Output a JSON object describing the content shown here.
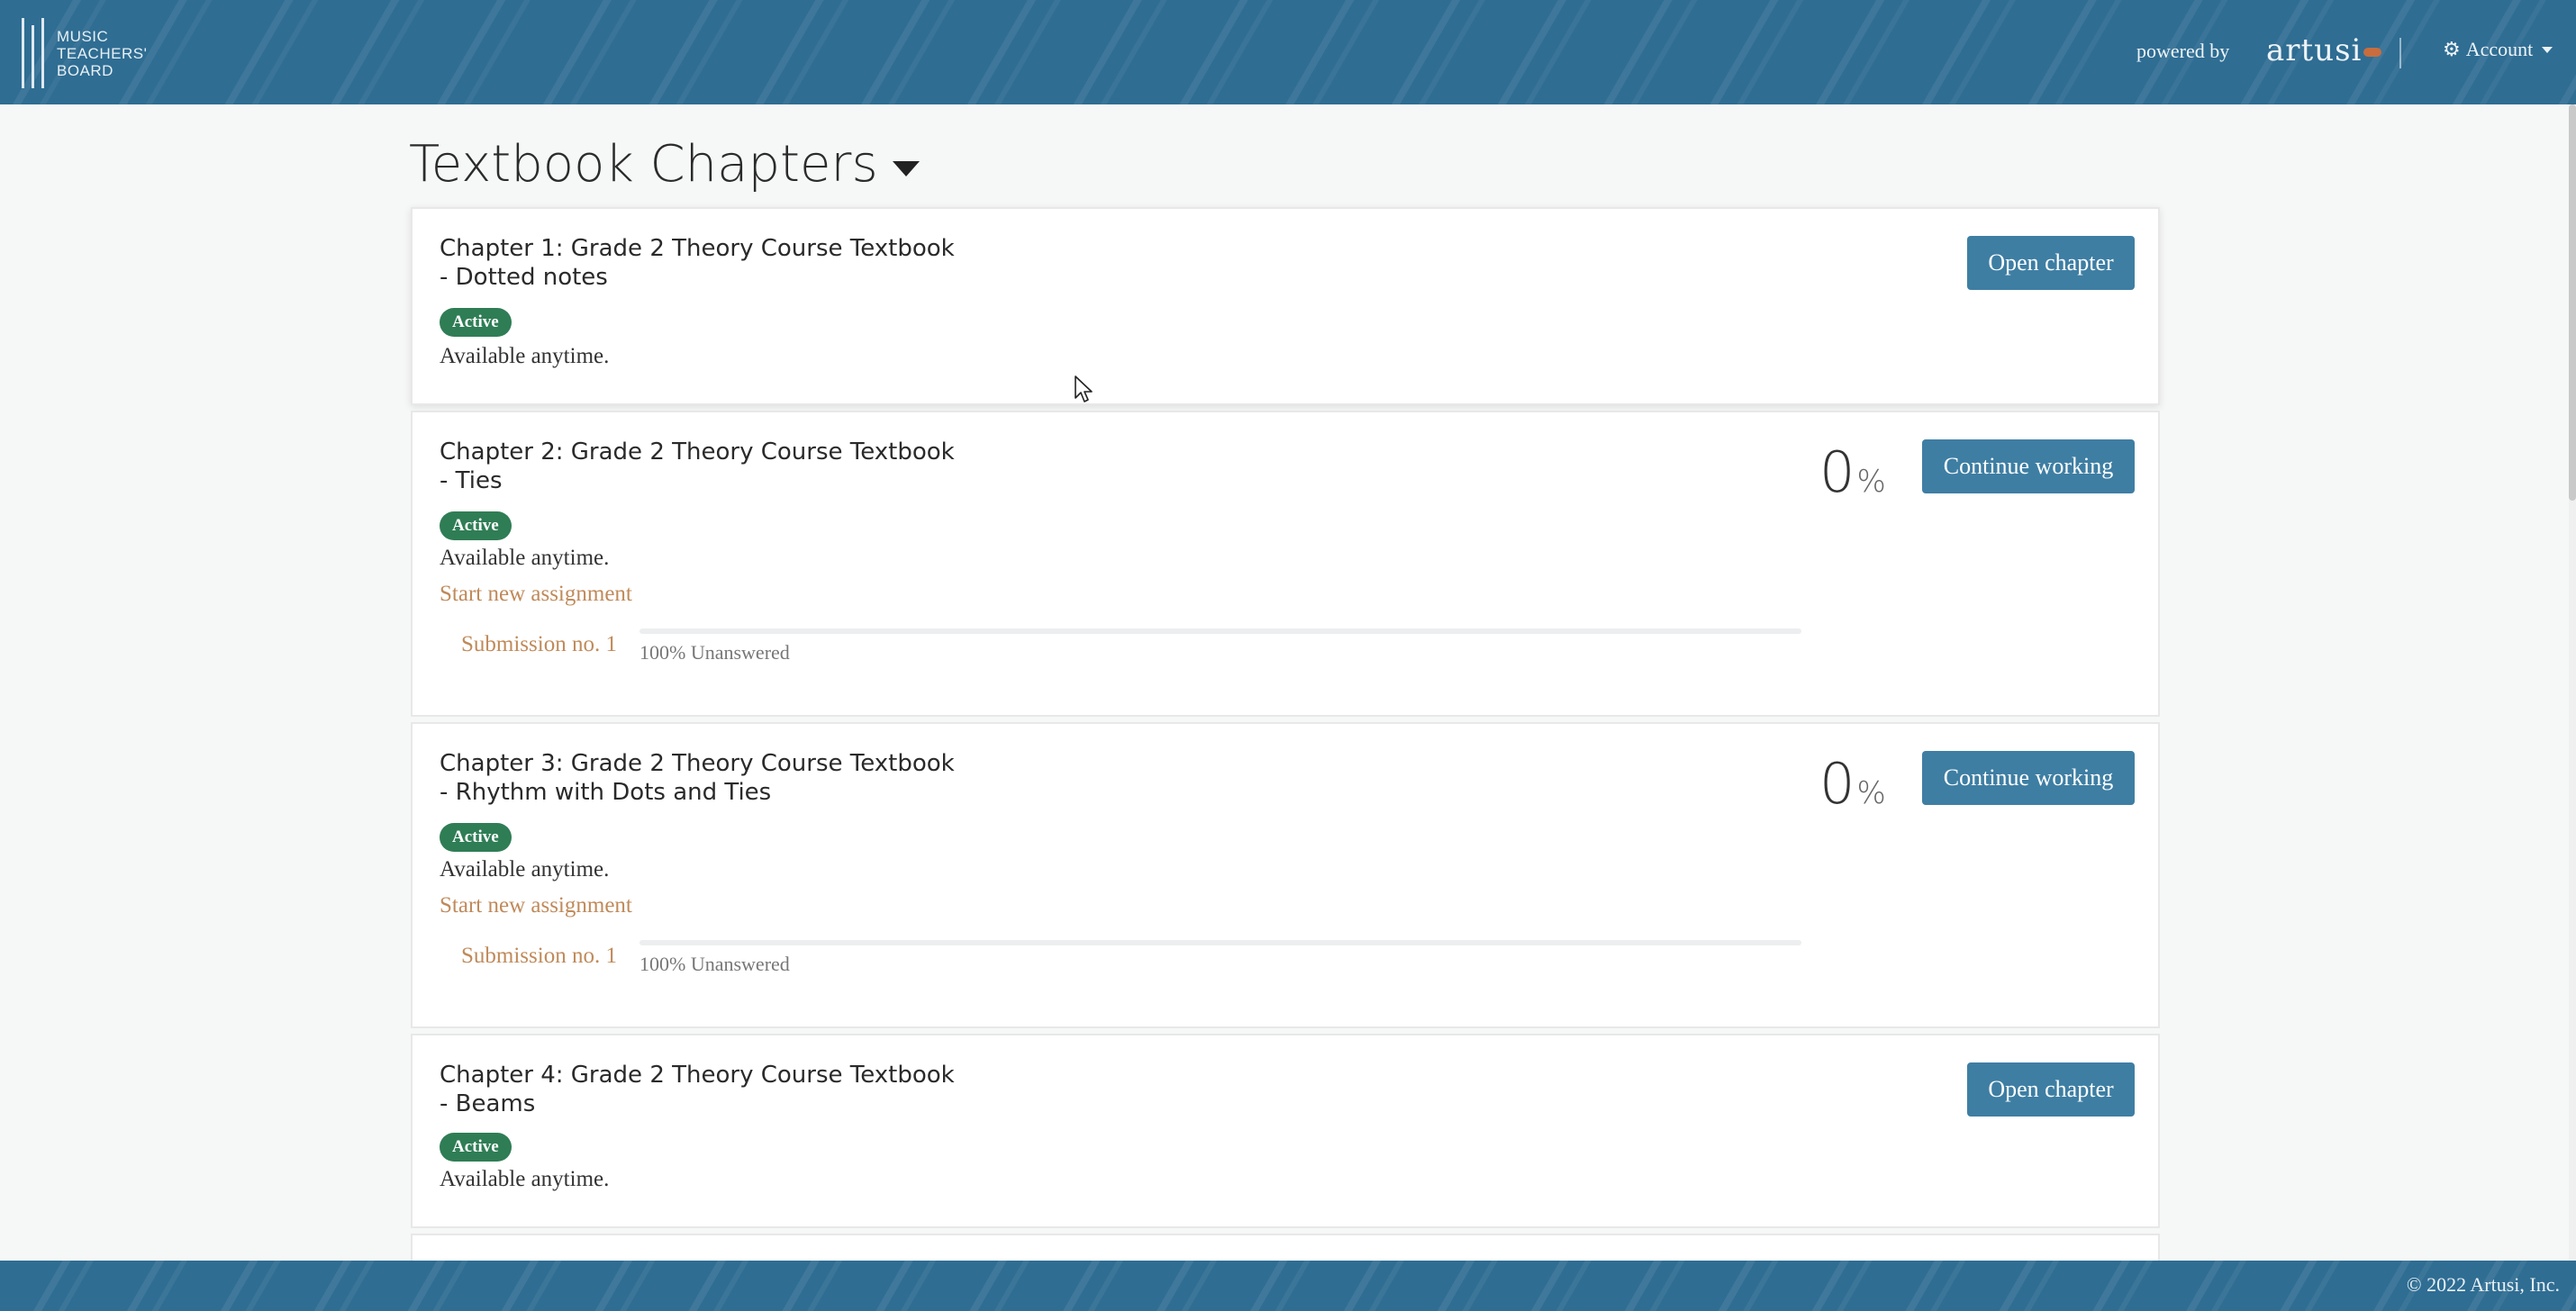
{
  "header": {
    "logo_lines": [
      "MUSIC",
      "TEACHERS'",
      "BOARD"
    ],
    "powered_by": "powered by",
    "brand": "artusi",
    "account_label": "Account",
    "colors": {
      "bar": "#2f6d93",
      "brand_accent": "#c76d3e"
    }
  },
  "page": {
    "title": "Textbook Chapters"
  },
  "chapters": [
    {
      "title_line1": "Chapter 1: Grade 2 Theory Course Textbook",
      "title_line2": "- Dotted notes",
      "badge": "Active",
      "availability": "Available anytime.",
      "button": "Open chapter"
    },
    {
      "title_line1": "Chapter 2: Grade 2 Theory Course Textbook",
      "title_line2": "- Ties",
      "badge": "Active",
      "availability": "Available anytime.",
      "start_link": "Start new assignment",
      "submission_label": "Submission no. 1",
      "progress_label": "100% Unanswered",
      "progress_fraction_answered": 0,
      "percent_value": "0",
      "percent_sign": "%",
      "button": "Continue working"
    },
    {
      "title_line1": "Chapter 3: Grade 2 Theory Course Textbook",
      "title_line2": "- Rhythm with Dots and Ties",
      "badge": "Active",
      "availability": "Available anytime.",
      "start_link": "Start new assignment",
      "submission_label": "Submission no. 1",
      "progress_label": "100% Unanswered",
      "progress_fraction_answered": 0,
      "percent_value": "0",
      "percent_sign": "%",
      "button": "Continue working"
    },
    {
      "title_line1": "Chapter 4: Grade 2 Theory Course Textbook",
      "title_line2": "- Beams",
      "badge": "Active",
      "availability": "Available anytime.",
      "button": "Open chapter"
    }
  ],
  "footer": {
    "copyright": "© 2022 Artusi, Inc."
  },
  "icons": {
    "account": "gear-icon",
    "title_toggle": "caret-down-icon",
    "cursor": "mouse-pointer-icon"
  }
}
